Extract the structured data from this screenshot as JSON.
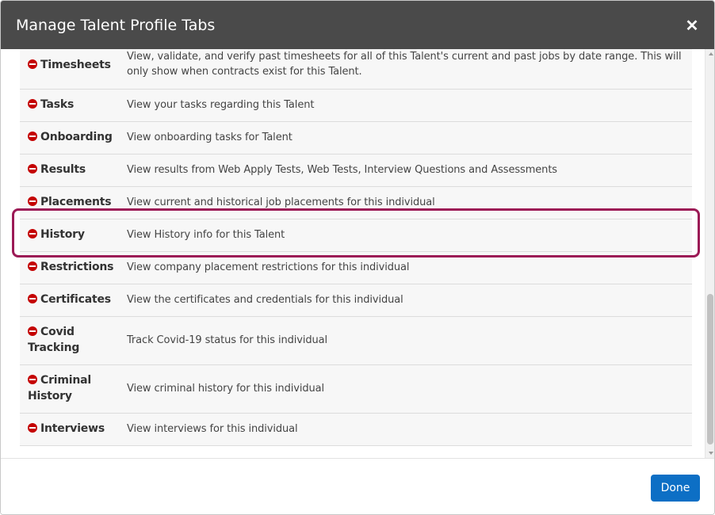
{
  "dialog": {
    "title": "Manage Talent Profile Tabs",
    "close_glyph": "✕"
  },
  "tabs": [
    {
      "name": "Timesheets",
      "description": "View, validate, and verify past timesheets for all of this Talent's current and past jobs by date range. This will only show when contracts exist for this Talent."
    },
    {
      "name": "Tasks",
      "description": "View your tasks regarding this Talent"
    },
    {
      "name": "Onboarding",
      "description": "View onboarding tasks for Talent"
    },
    {
      "name": "Results",
      "description": "View results from Web Apply Tests, Web Tests, Interview Questions and Assessments"
    },
    {
      "name": "Placements",
      "description": "View current and historical job placements for this individual"
    },
    {
      "name": "History",
      "description": "View History info for this Talent"
    },
    {
      "name": "Restrictions",
      "description": "View company placement restrictions for this individual"
    },
    {
      "name": "Certificates",
      "description": "View the certificates and credentials for this individual"
    },
    {
      "name": "Covid Tracking",
      "description": "Track Covid-19 status for this individual"
    },
    {
      "name": "Criminal History",
      "description": "View criminal history for this individual"
    },
    {
      "name": "Interviews",
      "description": "View interviews for this individual"
    }
  ],
  "highlighted_tab": "History",
  "footer": {
    "done_label": "Done"
  },
  "colors": {
    "header": "#4a4a4a",
    "remove_icon": "#c40000",
    "highlight": "#9c1a56",
    "done_button": "#0d6fc5"
  },
  "icons": {
    "remove": "minus-circle-icon",
    "close": "close-icon"
  }
}
